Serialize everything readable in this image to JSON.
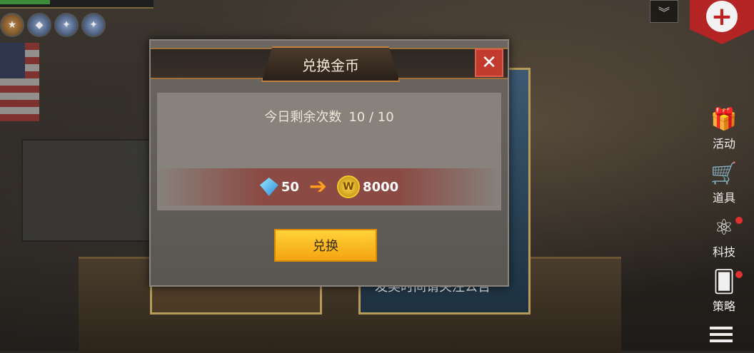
{
  "background": {
    "map_card_text": "发奖时间请关注公告"
  },
  "hud": {
    "dropdown_icon": "chevron-down-double-icon",
    "medic_icon": "red-cross-icon"
  },
  "side_menu": [
    {
      "label": "活动",
      "icon": "gift-icon",
      "notify": false
    },
    {
      "label": "道具",
      "icon": "cart-icon",
      "notify": false
    },
    {
      "label": "科技",
      "icon": "atom-icon",
      "notify": true
    },
    {
      "label": "策略",
      "icon": "cards-icon",
      "notify": true
    }
  ],
  "dialog": {
    "title": "兑换金币",
    "close_label": "✕",
    "remaining_label": "今日剩余次数",
    "remaining_value": "10 / 10",
    "cost_amount": "50",
    "reward_amount": "8000",
    "coin_letter": "W",
    "button_label": "兑换"
  },
  "colors": {
    "accent": "#f5a410",
    "close_red": "#c23a2e",
    "band_red": "#8b4a44"
  }
}
